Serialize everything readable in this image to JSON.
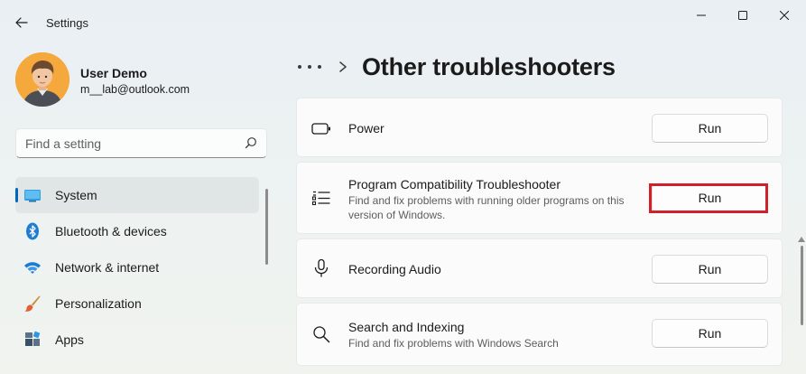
{
  "window": {
    "title": "Settings",
    "controls": {
      "minimize": "minimize",
      "maximize": "maximize",
      "close": "close"
    }
  },
  "profile": {
    "name": "User Demo",
    "email": "m__lab@outlook.com"
  },
  "search": {
    "placeholder": "Find a setting"
  },
  "sidebar": {
    "items": [
      {
        "label": "System",
        "icon": "monitor-icon",
        "active": true
      },
      {
        "label": "Bluetooth & devices",
        "icon": "bluetooth-icon",
        "active": false
      },
      {
        "label": "Network & internet",
        "icon": "wifi-icon",
        "active": false
      },
      {
        "label": "Personalization",
        "icon": "brush-icon",
        "active": false
      },
      {
        "label": "Apps",
        "icon": "apps-icon",
        "active": false
      }
    ]
  },
  "header": {
    "title": "Other troubleshooters"
  },
  "troubleshooters": [
    {
      "title": "Power",
      "description": "",
      "icon": "battery-icon",
      "button": "Run"
    },
    {
      "title": "Program Compatibility Troubleshooter",
      "description": "Find and fix problems with running older programs on this version of Windows.",
      "icon": "list-icon",
      "button": "Run",
      "highlighted": true
    },
    {
      "title": "Recording Audio",
      "description": "",
      "icon": "microphone-icon",
      "button": "Run"
    },
    {
      "title": "Search and Indexing",
      "description": "Find and fix problems with Windows Search",
      "icon": "search-icon",
      "button": "Run"
    }
  ],
  "colors": {
    "accent": "#0067c0",
    "highlight_border": "#d0202a"
  }
}
